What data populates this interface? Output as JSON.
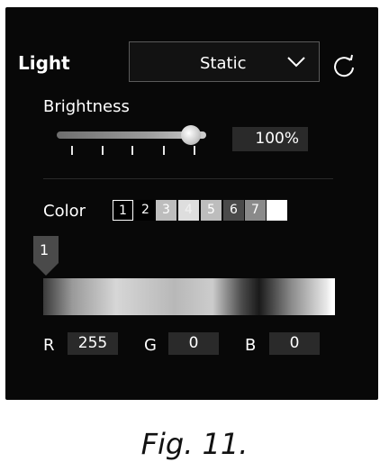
{
  "header": {
    "title": "Light",
    "mode_value": "Static"
  },
  "brightness": {
    "label": "Brightness",
    "value_text": "100%",
    "level": 1.0
  },
  "color": {
    "label": "Color",
    "swatches": [
      {
        "label": "1",
        "bg": "#000000",
        "fg": "#ffffff",
        "selected": true
      },
      {
        "label": "2",
        "bg": "#000000",
        "fg": "#ffffff",
        "selected": false
      },
      {
        "label": "3",
        "bg": "#bdbdbd",
        "fg": "#ffffff",
        "selected": false
      },
      {
        "label": "4",
        "bg": "#dedede",
        "fg": "#f0f0f0",
        "selected": false
      },
      {
        "label": "5",
        "bg": "#bdbdbd",
        "fg": "#ffffff",
        "selected": false
      },
      {
        "label": "6",
        "bg": "#4a4a4a",
        "fg": "#ffffff",
        "selected": false
      },
      {
        "label": "7",
        "bg": "#8a8a8a",
        "fg": "#ffffff",
        "selected": false
      },
      {
        "label": "",
        "bg": "#ffffff",
        "fg": "#000000",
        "selected": false
      }
    ],
    "active_marker": "1",
    "channels": [
      {
        "label": "R",
        "value": "255"
      },
      {
        "label": "G",
        "value": "0"
      },
      {
        "label": "B",
        "value": "0"
      }
    ]
  },
  "caption": "Fig. 11.",
  "icons": {
    "mode_dropdown": "chevron-down-icon",
    "refresh": "refresh-icon",
    "marker": "stop-marker-icon"
  },
  "colors": {
    "panel_bg": "#080808",
    "field_bg": "#2a2a2a",
    "text": "#ffffff"
  }
}
